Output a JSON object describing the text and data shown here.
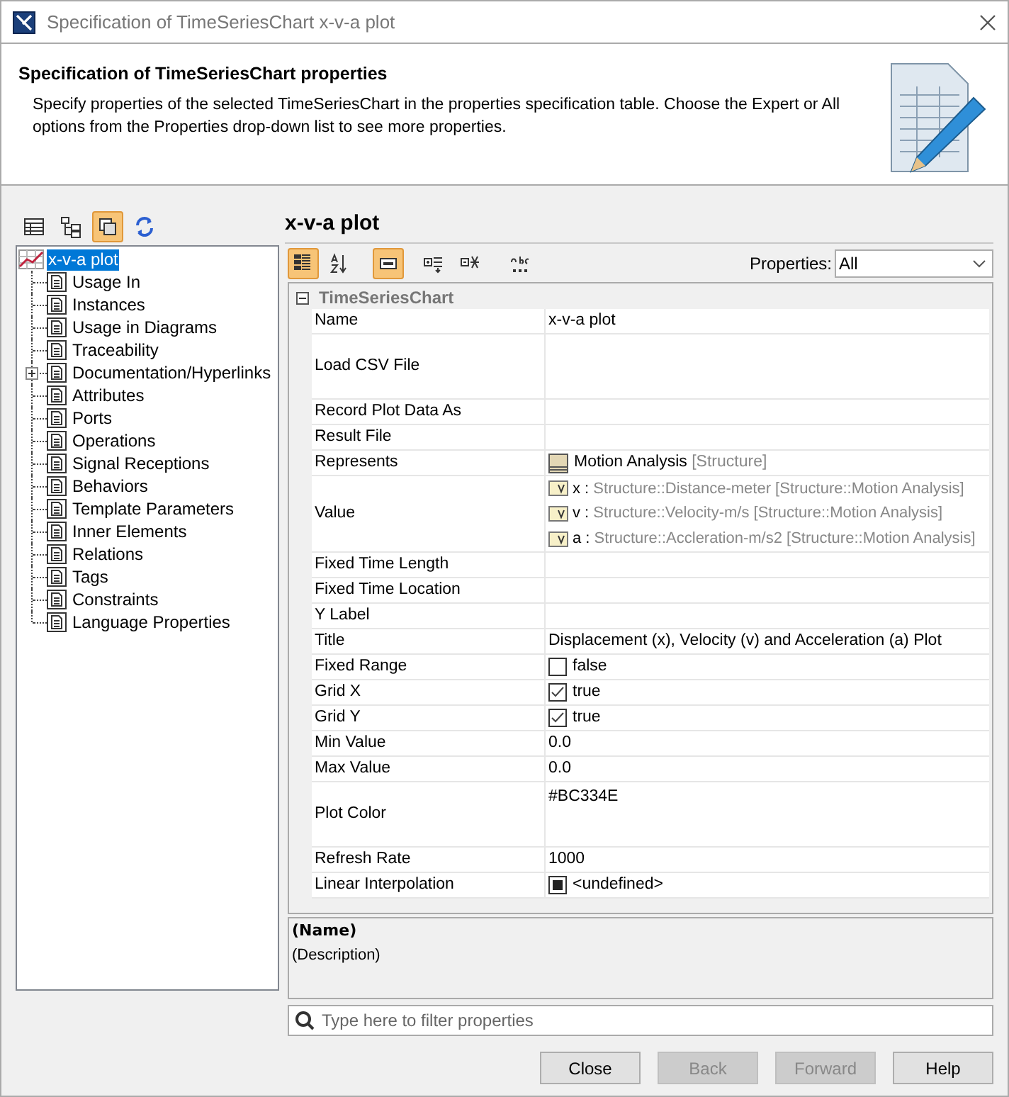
{
  "window": {
    "title": "Specification of TimeSeriesChart x-v-a plot"
  },
  "header": {
    "title": "Specification of TimeSeriesChart properties",
    "description": "Specify properties of the selected TimeSeriesChart in the properties specification table. Choose the Expert or All options from the Properties drop-down list to see more properties."
  },
  "tree_toolbar": [
    {
      "selected": false
    },
    {
      "selected": false
    },
    {
      "selected": true
    },
    {
      "selected": false
    }
  ],
  "tree": {
    "label": "x-v-a plot",
    "selected": true,
    "children": [
      {
        "label": "Usage In",
        "selected": false,
        "expandable": false
      },
      {
        "label": "Instances",
        "selected": false,
        "expandable": false
      },
      {
        "label": "Usage in Diagrams",
        "selected": false,
        "expandable": false
      },
      {
        "label": "Traceability",
        "selected": false,
        "expandable": false
      },
      {
        "label": "Documentation/Hyperlinks",
        "selected": false,
        "expandable": true
      },
      {
        "label": "Attributes",
        "selected": false,
        "expandable": false
      },
      {
        "label": "Ports",
        "selected": false,
        "expandable": false
      },
      {
        "label": "Operations",
        "selected": false,
        "expandable": false
      },
      {
        "label": "Signal Receptions",
        "selected": false,
        "expandable": false
      },
      {
        "label": "Behaviors",
        "selected": false,
        "expandable": false
      },
      {
        "label": "Template Parameters",
        "selected": false,
        "expandable": false
      },
      {
        "label": "Inner Elements",
        "selected": false,
        "expandable": false
      },
      {
        "label": "Relations",
        "selected": false,
        "expandable": false
      },
      {
        "label": "Tags",
        "selected": false,
        "expandable": false
      },
      {
        "label": "Constraints",
        "selected": false,
        "expandable": false
      },
      {
        "label": "Language Properties",
        "selected": false,
        "expandable": false
      }
    ]
  },
  "panel_title": "x-v-a plot",
  "table_toolbar": [
    {
      "selected": true
    },
    {
      "selected": false
    },
    {
      "selected": true
    },
    {
      "selected": false
    },
    {
      "selected": false
    },
    {
      "selected": false
    }
  ],
  "properties_filter": {
    "label": "Properties:",
    "value": "All"
  },
  "properties": {
    "group": "TimeSeriesChart",
    "expanded": true,
    "rows": [
      {
        "name": "Name",
        "kind": "text",
        "value": "x-v-a plot"
      },
      {
        "name": "Load CSV File",
        "kind": "multiline"
      },
      {
        "name": "Record Plot Data As",
        "kind": "text"
      },
      {
        "name": "Result File",
        "kind": "text"
      },
      {
        "name": "Represents",
        "kind": "ref",
        "value": "Motion Analysis",
        "owner": "[Structure]"
      },
      {
        "name": "Value",
        "kind": "refs",
        "items": [
          {
            "name": "x :",
            "type": "Structure::Distance-meter",
            "owner": "[Structure::Motion Analysis]"
          },
          {
            "name": "v :",
            "type": "Structure::Velocity-m/s",
            "owner": "[Structure::Motion Analysis]"
          },
          {
            "name": "a :",
            "type": "Structure::Accleration-m/s2",
            "owner": "[Structure::Motion Analysis]"
          }
        ]
      },
      {
        "name": "Fixed Time Length",
        "kind": "text"
      },
      {
        "name": "Fixed Time Location",
        "kind": "text"
      },
      {
        "name": "Y Label",
        "kind": "text"
      },
      {
        "name": "Title",
        "kind": "text",
        "value": "Displacement (x), Velocity (v) and Acceleration (a) Plot"
      },
      {
        "name": "Fixed Range",
        "kind": "checkbox",
        "checked": false,
        "indeterminate": false,
        "value": "false"
      },
      {
        "name": "Grid X",
        "kind": "checkbox",
        "checked": true,
        "indeterminate": false,
        "value": "true"
      },
      {
        "name": "Grid Y",
        "kind": "checkbox",
        "checked": true,
        "indeterminate": false,
        "value": "true"
      },
      {
        "name": "Min Value",
        "kind": "text",
        "value": "0.0"
      },
      {
        "name": "Max Value",
        "kind": "text",
        "value": "0.0"
      },
      {
        "name": "Plot Color",
        "kind": "multiline",
        "value": "#BC334E"
      },
      {
        "name": "Refresh Rate",
        "kind": "text",
        "value": "1000"
      },
      {
        "name": "Linear Interpolation",
        "kind": "checkbox",
        "indeterminate": true,
        "value": "<undefined>"
      }
    ]
  },
  "description": {
    "name": "(Name)",
    "text": "(Description)"
  },
  "filter": {
    "placeholder": "Type here to filter properties"
  },
  "buttons": [
    {
      "label": "Close",
      "disabled": false
    },
    {
      "label": "Back",
      "disabled": true
    },
    {
      "label": "Forward",
      "disabled": true
    },
    {
      "label": "Help",
      "disabled": false
    }
  ]
}
